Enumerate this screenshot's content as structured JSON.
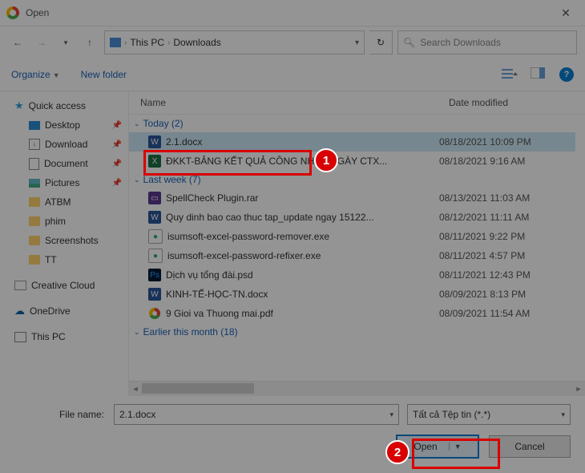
{
  "title": "Open",
  "breadcrumb": {
    "pc": "This PC",
    "folder": "Downloads"
  },
  "search_placeholder": "Search Downloads",
  "toolbar": {
    "organize": "Organize",
    "newfolder": "New folder"
  },
  "columns": {
    "name": "Name",
    "date": "Date modified"
  },
  "sidebar": {
    "quick": "Quick access",
    "desktop": "Desktop",
    "download": "Download",
    "document": "Document",
    "pictures": "Pictures",
    "atbm": "ATBM",
    "phim": "phim",
    "screenshots": "Screenshots",
    "tt": "TT",
    "cc": "Creative Cloud",
    "onedrive": "OneDrive",
    "thispc": "This PC"
  },
  "groups": {
    "today": "Today (2)",
    "lastweek": "Last week (7)",
    "earlier": "Earlier this month (18)"
  },
  "files": {
    "f1": {
      "name": "2.1.docx",
      "date": "08/18/2021 10:09 PM"
    },
    "f2": {
      "name": "ĐKKT-BẢNG KẾT QUẢ CÔNG NHẬN NGÀY CTX...",
      "date": "08/18/2021 9:16 AM"
    },
    "f3": {
      "name": "SpellCheck Plugin.rar",
      "date": "08/13/2021 11:03 AM"
    },
    "f4": {
      "name": "Quy dinh bao cao thuc tap_update ngay 15122...",
      "date": "08/12/2021 11:11 AM"
    },
    "f5": {
      "name": "isumsoft-excel-password-remover.exe",
      "date": "08/11/2021 9:22 PM"
    },
    "f6": {
      "name": "isumsoft-excel-password-refixer.exe",
      "date": "08/11/2021 4:57 PM"
    },
    "f7": {
      "name": "Dịch vụ tổng đài.psd",
      "date": "08/11/2021 12:43 PM"
    },
    "f8": {
      "name": "KINH-TẾ-HỌC-TN.docx",
      "date": "08/09/2021 8:13 PM"
    },
    "f9": {
      "name": "9 Gioi va Thuong mai.pdf",
      "date": "08/09/2021 11:54 AM"
    }
  },
  "filename_label": "File name:",
  "filename_value": "2.1.docx",
  "filter_value": "Tất cả Tệp tin (*.*)",
  "buttons": {
    "open": "Open",
    "cancel": "Cancel"
  },
  "annotations": {
    "a1": "1",
    "a2": "2"
  }
}
